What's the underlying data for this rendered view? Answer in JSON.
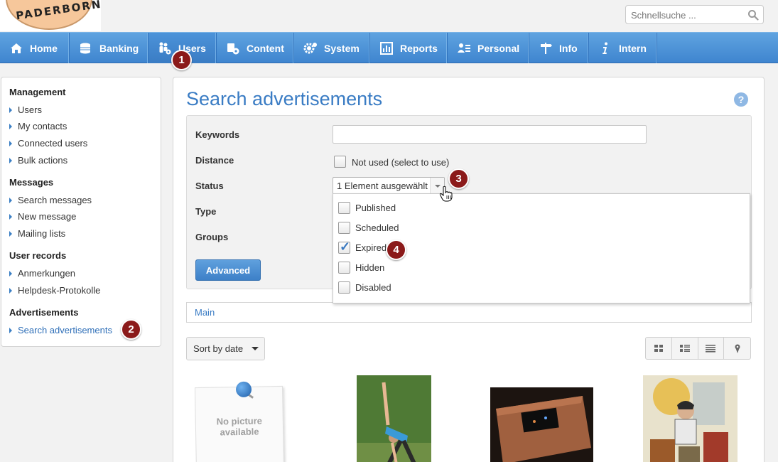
{
  "header": {
    "logo_text": "PADERBORN",
    "search_placeholder": "Schnellsuche ..."
  },
  "nav": {
    "items": [
      {
        "label": "Home",
        "icon": "home-icon"
      },
      {
        "label": "Banking",
        "icon": "coins-icon"
      },
      {
        "label": "Users",
        "icon": "users-gear-icon"
      },
      {
        "label": "Content",
        "icon": "content-gear-icon"
      },
      {
        "label": "System",
        "icon": "gears-icon"
      },
      {
        "label": "Reports",
        "icon": "chart-icon"
      },
      {
        "label": "Personal",
        "icon": "id-card-icon"
      },
      {
        "label": "Info",
        "icon": "signpost-icon"
      },
      {
        "label": "Intern",
        "icon": "info-i-icon"
      }
    ],
    "active": "Users"
  },
  "annotations": {
    "n1": "1",
    "n2": "2",
    "n3": "3",
    "n4": "4"
  },
  "sidebar": {
    "sections": [
      {
        "title": "Management",
        "items": [
          "Users",
          "My contacts",
          "Connected users",
          "Bulk actions"
        ]
      },
      {
        "title": "Messages",
        "items": [
          "Search messages",
          "New message",
          "Mailing lists"
        ]
      },
      {
        "title": "User records",
        "items": [
          "Anmerkungen",
          "Helpdesk-Protokolle"
        ]
      },
      {
        "title": "Advertisements",
        "items": [
          "Search advertisements"
        ]
      }
    ]
  },
  "main": {
    "title": "Search advertisements",
    "help": "?",
    "form": {
      "keywords_label": "Keywords",
      "keywords_value": "",
      "distance_label": "Distance",
      "distance_checkbox": "Not used (select to use)",
      "status_label": "Status",
      "status_value": "1 Element ausgewählt",
      "type_label": "Type",
      "groups_label": "Groups",
      "advanced_button": "Advanced"
    },
    "status_options": [
      {
        "label": "Published",
        "checked": false
      },
      {
        "label": "Scheduled",
        "checked": false
      },
      {
        "label": "Expired",
        "checked": true
      },
      {
        "label": "Hidden",
        "checked": false
      },
      {
        "label": "Disabled",
        "checked": false
      }
    ],
    "tab": "Main",
    "sort_label": "Sort by date",
    "no_picture": "No picture\navailable",
    "colors": {
      "accent": "#3a7cc4",
      "badge": "#8b1a1a"
    }
  }
}
